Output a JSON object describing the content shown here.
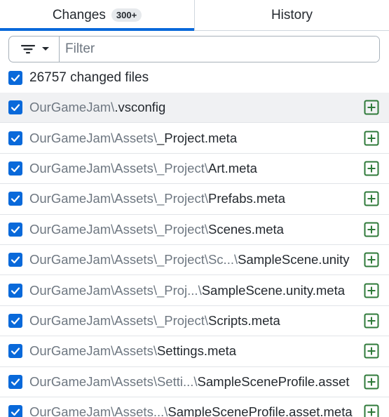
{
  "tabs": [
    {
      "label": "Changes",
      "badge": "300+"
    },
    {
      "label": "History"
    }
  ],
  "filter": {
    "placeholder": "Filter",
    "button_icon": "filter-icon"
  },
  "summary": {
    "label": "26757 changed files",
    "checked": true
  },
  "colors": {
    "accent": "#0969da",
    "added": "#2f7a3a"
  },
  "files": [
    {
      "dir": "OurGameJam\\",
      "name": ".vsconfig",
      "status_icon": "file-added-icon",
      "selected": true
    },
    {
      "dir": "OurGameJam\\Assets\\",
      "name": "_Project.meta",
      "status_icon": "file-added-icon"
    },
    {
      "dir": "OurGameJam\\Assets\\_Project\\",
      "name": "Art.meta",
      "status_icon": "file-added-icon"
    },
    {
      "dir": "OurGameJam\\Assets\\_Project\\",
      "name": "Prefabs.meta",
      "status_icon": "file-added-icon"
    },
    {
      "dir": "OurGameJam\\Assets\\_Project\\",
      "name": "Scenes.meta",
      "status_icon": "file-added-icon"
    },
    {
      "dir": "OurGameJam\\Assets\\_Project\\Sc...\\",
      "name": "SampleScene.unity",
      "status_icon": "file-added-icon"
    },
    {
      "dir": "OurGameJam\\Assets\\_Proj...\\",
      "name": "SampleScene.unity.meta",
      "status_icon": "file-added-icon"
    },
    {
      "dir": "OurGameJam\\Assets\\_Project\\",
      "name": "Scripts.meta",
      "status_icon": "file-added-icon"
    },
    {
      "dir": "OurGameJam\\Assets\\",
      "name": "Settings.meta",
      "status_icon": "file-added-icon"
    },
    {
      "dir": "OurGameJam\\Assets\\Setti...\\",
      "name": "SampleSceneProfile.asset",
      "status_icon": "file-added-icon"
    },
    {
      "dir": "OurGameJam\\Assets...\\",
      "name": "SampleSceneProfile.asset.meta",
      "status_icon": "file-added-icon"
    }
  ]
}
